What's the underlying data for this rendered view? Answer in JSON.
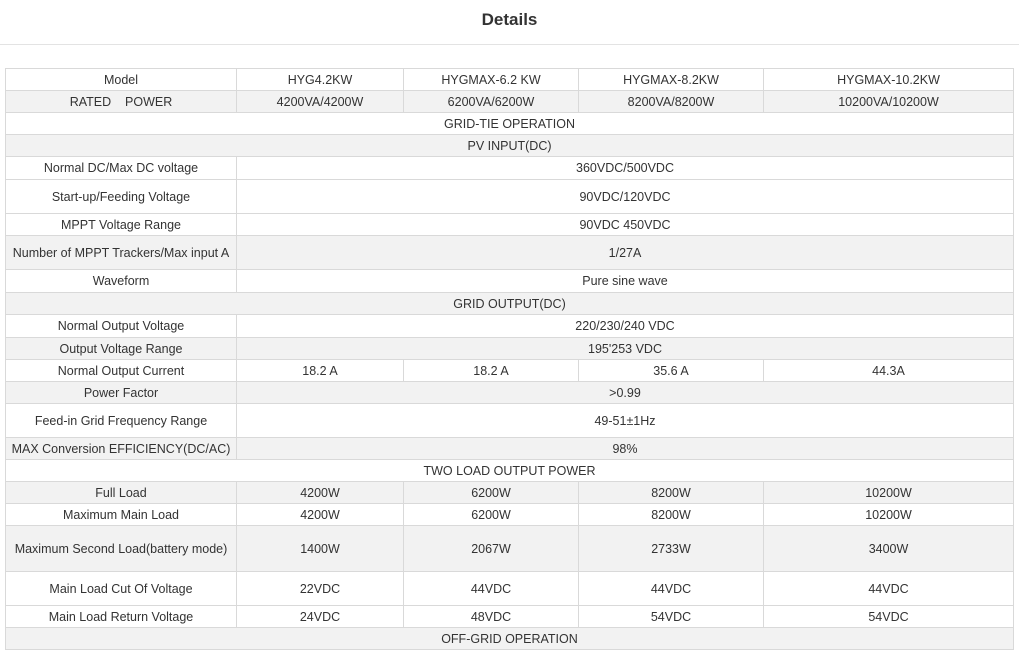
{
  "page": {
    "title": "Details"
  },
  "table": {
    "header": {
      "label": "Model",
      "models": [
        "HYG4.2KW",
        "HYGMAX-6.2 KW",
        "HYGMAX-8.2KW",
        "HYGMAX-10.2KW"
      ]
    },
    "rated_power": {
      "label": "RATED    POWER",
      "values": [
        "4200VA/4200W",
        "6200VA/6200W",
        "8200VA/8200W",
        "10200VA/10200W"
      ]
    },
    "sections": {
      "grid_tie": "GRID-TIE OPERATION",
      "pv_input": "PV INPUT(DC)",
      "grid_output": "GRID OUTPUT(DC)",
      "two_load": "TWO LOAD OUTPUT POWER",
      "off_grid": "OFF-GRID OPERATION"
    },
    "pv_rows": [
      {
        "label": "Normal DC/Max DC voltage",
        "value": "360VDC/500VDC"
      },
      {
        "label": "Start-up/Feeding Voltage",
        "value": "90VDC/120VDC"
      },
      {
        "label": "MPPT Voltage Range",
        "value": "90VDC 450VDC"
      },
      {
        "label": "Number of MPPT Trackers/Max input A",
        "value": "1/27A"
      },
      {
        "label": "Waveform",
        "value": "Pure sine wave"
      }
    ],
    "grid_rows": {
      "normal_output_voltage": {
        "label": "Normal Output Voltage",
        "value": "220/230/240 VDC"
      },
      "output_voltage_range": {
        "label": "Output Voltage Range",
        "value": "195'253 VDC"
      },
      "normal_output_current": {
        "label": "Normal Output Current",
        "values": [
          "18.2 A",
          "18.2 A",
          "35.6 A",
          "44.3A"
        ]
      },
      "power_factor": {
        "label": "Power Factor",
        "value": ">0.99"
      },
      "frequency_range": {
        "label": "Feed-in Grid Frequency Range",
        "value": "49-51±1Hz"
      },
      "efficiency": {
        "label": "MAX Conversion EFFICIENCY(DC/AC)",
        "value": "98%"
      }
    },
    "load_rows": [
      {
        "label": "Full Load",
        "values": [
          "4200W",
          "6200W",
          "8200W",
          "10200W"
        ]
      },
      {
        "label": "Maximum Main Load",
        "values": [
          "4200W",
          "6200W",
          "8200W",
          "10200W"
        ]
      },
      {
        "label": "Maximum Second Load(battery mode)",
        "values": [
          "1400W",
          "2067W",
          "2733W",
          "3400W"
        ]
      },
      {
        "label": "Main Load Cut Of Voltage",
        "values": [
          "22VDC",
          "44VDC",
          "44VDC",
          "44VDC"
        ]
      },
      {
        "label": "Main Load Return Voltage",
        "values": [
          "24VDC",
          "48VDC",
          "54VDC",
          "54VDC"
        ]
      }
    ]
  }
}
